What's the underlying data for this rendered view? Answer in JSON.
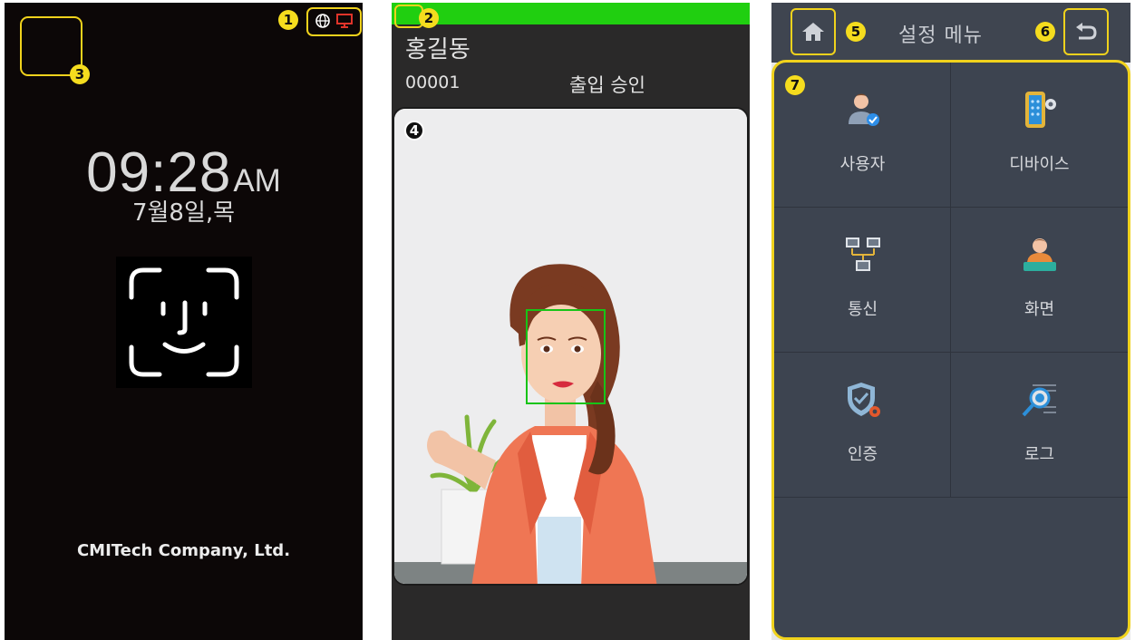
{
  "idle_screen": {
    "callout_1": "1",
    "callout_3": "3",
    "time": "09:28",
    "ampm": "AM",
    "date": "7월8일,목",
    "company": "CMITech Company, Ltd.",
    "status_icons": [
      "globe-icon",
      "monitor-icon"
    ],
    "monitor_color": "#e0342a"
  },
  "result_screen": {
    "callout_2": "2",
    "callout_4": "4",
    "name": "홍길동",
    "user_id": "00001",
    "status": "출입 승인",
    "bar_color": "#20cf10",
    "face_box_color": "#17c417"
  },
  "settings_screen": {
    "callout_5": "5",
    "callout_6": "6",
    "callout_7": "7",
    "title": "설정 메뉴",
    "home_icon": "home-icon",
    "back_icon": "back-arrow-icon",
    "menu": [
      {
        "label": "사용자",
        "icon": "user-icon"
      },
      {
        "label": "디바이스",
        "icon": "device-icon"
      },
      {
        "label": "통신",
        "icon": "network-icon"
      },
      {
        "label": "화면",
        "icon": "display-icon"
      },
      {
        "label": "인증",
        "icon": "shield-icon"
      },
      {
        "label": "로그",
        "icon": "log-search-icon"
      }
    ]
  }
}
